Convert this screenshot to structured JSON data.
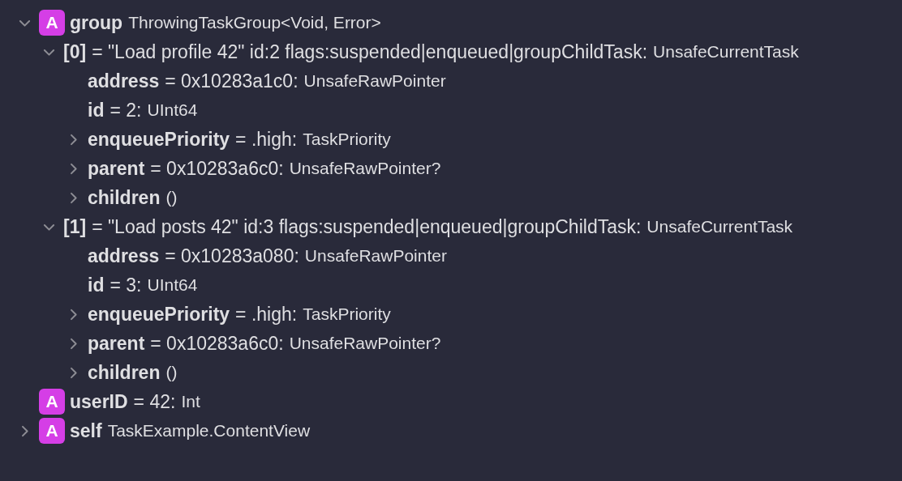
{
  "variables": [
    {
      "name": "group",
      "badge": "A",
      "type": "ThrowingTaskGroup<Void, Error>",
      "expandable": true,
      "expanded": true,
      "children": [
        {
          "name": "[0]",
          "value": "= \"Load profile 42\" id:2 flags:suspended|enqueued|groupChildTask:",
          "type": "UnsafeCurrentTask",
          "expandable": true,
          "expanded": true,
          "children": [
            {
              "name": "address",
              "value": "= 0x10283a1c0:",
              "type": "UnsafeRawPointer",
              "expandable": false
            },
            {
              "name": "id",
              "value": "= 2:",
              "type": "UInt64",
              "expandable": false
            },
            {
              "name": "enqueuePriority",
              "value": "= .high:",
              "type": "TaskPriority",
              "expandable": true,
              "expanded": false
            },
            {
              "name": "parent",
              "value": "= 0x10283a6c0:",
              "type": "UnsafeRawPointer?",
              "expandable": true,
              "expanded": false
            },
            {
              "name": "children",
              "type": "()",
              "expandable": true,
              "expanded": false
            }
          ]
        },
        {
          "name": "[1]",
          "value": "= \"Load posts 42\" id:3 flags:suspended|enqueued|groupChildTask:",
          "type": "UnsafeCurrentTask",
          "expandable": true,
          "expanded": true,
          "children": [
            {
              "name": "address",
              "value": "= 0x10283a080:",
              "type": "UnsafeRawPointer",
              "expandable": false
            },
            {
              "name": "id",
              "value": "= 3:",
              "type": "UInt64",
              "expandable": false
            },
            {
              "name": "enqueuePriority",
              "value": "= .high:",
              "type": "TaskPriority",
              "expandable": true,
              "expanded": false
            },
            {
              "name": "parent",
              "value": "= 0x10283a6c0:",
              "type": "UnsafeRawPointer?",
              "expandable": true,
              "expanded": false
            },
            {
              "name": "children",
              "type": "()",
              "expandable": true,
              "expanded": false
            }
          ]
        }
      ]
    },
    {
      "name": "userID",
      "badge": "A",
      "value": "= 42:",
      "type": "Int",
      "expandable": false
    },
    {
      "name": "self",
      "badge": "A",
      "type": "TaskExample.ContentView",
      "expandable": true,
      "expanded": false
    }
  ]
}
